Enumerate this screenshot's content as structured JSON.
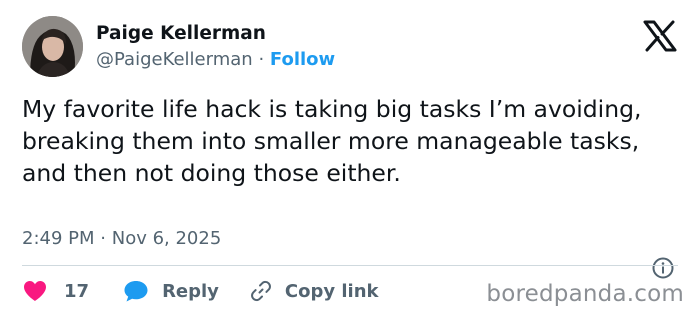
{
  "author": {
    "name": "Paige Kellerman",
    "handle": "@PaigeKellerman",
    "separator": "·",
    "follow_label": "Follow"
  },
  "tweet": {
    "text": "My favorite life hack is taking big tasks I’m avoiding, breaking them into smaller more manageable tasks, and then not doing those either.",
    "time": "2:49 PM",
    "date_separator": "·",
    "date": "Nov 6, 2025"
  },
  "actions": {
    "like_count": "17",
    "reply_label": "Reply",
    "copy_link_label": "Copy link"
  },
  "icons": {
    "platform": "x-logo-icon",
    "info": "info-icon",
    "like": "heart-icon",
    "reply": "speech-bubble-icon",
    "copy_link": "link-icon"
  },
  "colors": {
    "text": "#0f1419",
    "secondary": "#536471",
    "follow": "#1d9bf0",
    "like": "#f91880",
    "reply": "#1d9bf0",
    "divider": "#cfd9de"
  },
  "watermark": "boredpanda.com"
}
